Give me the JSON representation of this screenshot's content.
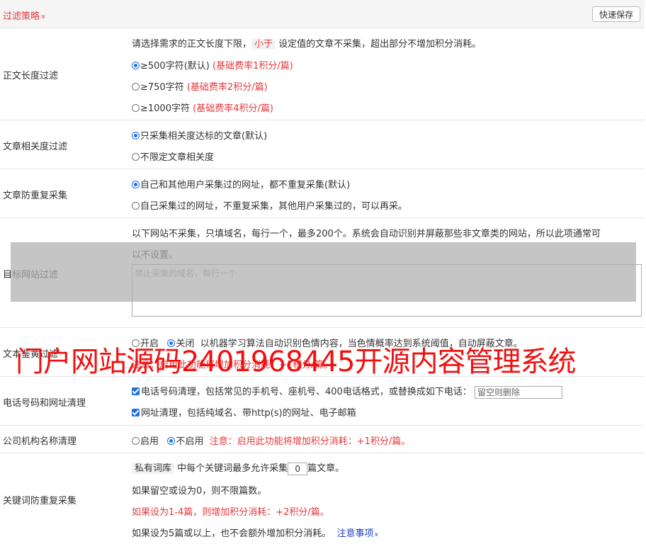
{
  "header": {
    "title": "过滤策略",
    "chevron": "»",
    "save_label": "快速保存"
  },
  "length_filter": {
    "label": "正文长度过滤",
    "desc_pre": "请选择需求的正文长度下限，",
    "desc_hl": "小于",
    "desc_post": "设定值的文章不采集，超出部分不增加积分消耗。",
    "options": [
      {
        "text": "≥500字符(默认)",
        "note": "(基础费率1积分/篇)",
        "selected": true
      },
      {
        "text": "≥750字符",
        "note": "(基础费率2积分/篇)",
        "selected": false
      },
      {
        "text": "≥1000字符",
        "note": "(基础费率4积分/篇)",
        "selected": false
      }
    ]
  },
  "relevance": {
    "label": "文章相关度过滤",
    "options": [
      {
        "text": "只采集相关度达标的文章(默认)",
        "selected": true
      },
      {
        "text": "不限定文章相关度",
        "selected": false
      }
    ]
  },
  "dedupe": {
    "label": "文章防重复采集",
    "options": [
      {
        "text": "自己和其他用户采集过的网址，都不重复采集(默认)",
        "selected": true
      },
      {
        "text": "自己采集过的网址，不重复采集，其他用户采集过的，可以再采。",
        "selected": false
      }
    ]
  },
  "site_filter": {
    "label": "目标网站过滤",
    "desc_line1": "以下网站不采集，只填域名，每行一个，最多200个。系统会自动识别并屏蔽那些非文章类的网站，所以此项通常可",
    "desc_line2": "以不设置。",
    "placeholder": "禁止采集的域名，每行一个"
  },
  "porn_filter": {
    "label": "文本鉴黄过滤",
    "on_label": "开启",
    "off_label": "关闭",
    "desc": "以机器学习算法自动识别色情内容，当色情概率达到系统阈值，自动屏蔽文章。",
    "note": "注意：启用此功能将增加积分消耗：+1积分/篇。"
  },
  "phone_url": {
    "label": "电话号码和网址清理",
    "phone_text": "电话号码清理，包括常见的手机号、座机号、400电话格式，或替换成如下电话：",
    "phone_placeholder": "留空则删除",
    "url_text": "网址清理，包括纯域名、带http(s)的网址、电子邮箱"
  },
  "company": {
    "label": "公司机构名称清理",
    "on_label": "启用",
    "off_label": "不启用",
    "note": "注意：启用此功能将增加积分消耗：+1积分/篇。"
  },
  "keyword": {
    "label": "关键词防重复采集",
    "tag": "私有词库",
    "line1_mid": "中每个关键词最多允许采集",
    "count": "0",
    "line1_post": "篇文章。",
    "line2": "如果留空或设为0，则不限篇数。",
    "line3": "如果设为1-4篇，则增加积分消耗：+2积分/篇。",
    "line4": "如果设为5篇或以上，也不会额外增加积分消耗。",
    "notes_link": "注意事项"
  },
  "watermark": {
    "text": "门户网站源码2401968445开源内容管理系统"
  },
  "colors": {
    "accent_red": "#e4393c",
    "radio_blue": "#1a73e8",
    "link_blue": "#1a3cc2",
    "watermark_red": "#f01010"
  }
}
